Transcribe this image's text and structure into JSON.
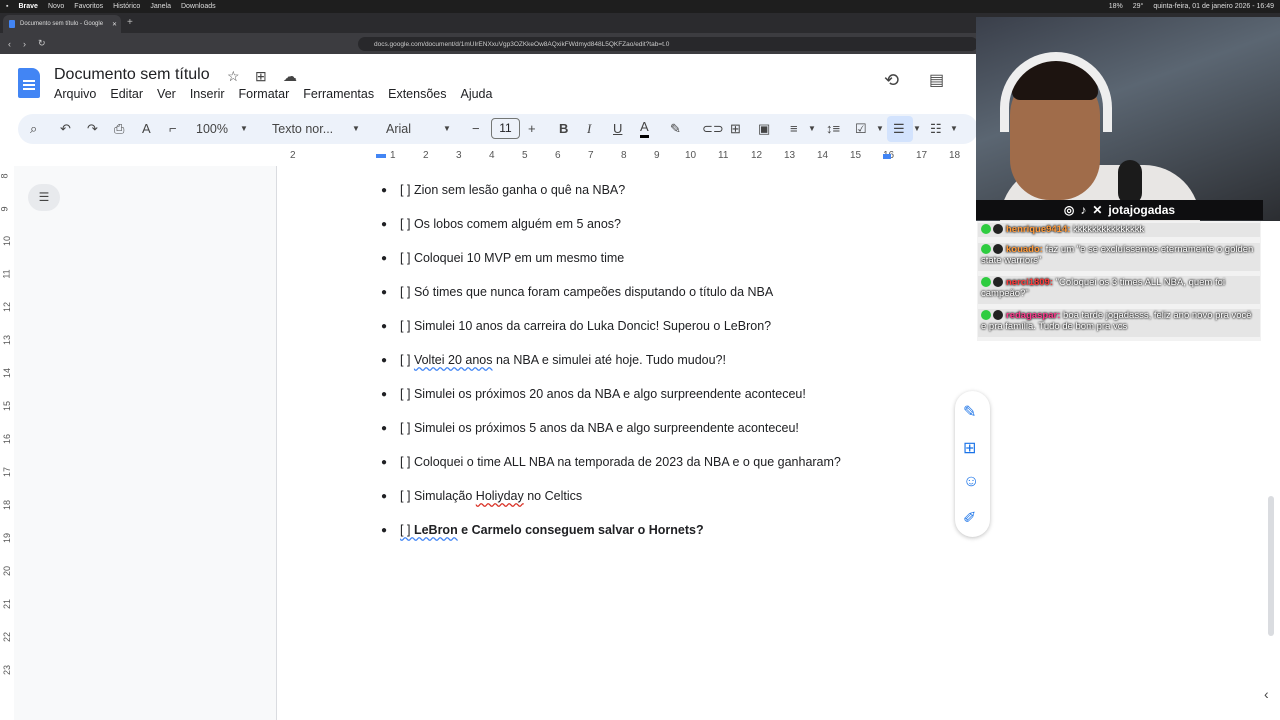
{
  "system_menubar": {
    "app": "Brave",
    "items": [
      "Novo",
      "Favoritos",
      "Histórico",
      "Janela",
      "Downloads"
    ],
    "status": [
      "18%",
      "29°",
      "quinta-feira, 01 de janeiro 2026 - 16:49"
    ]
  },
  "browser": {
    "tab_title": "Documento sem título - Google",
    "url": "docs.google.com/document/d/1mUIrENXxuVgp3OZKkeOw8AQxikFWdmyd848L5QKFZao/edit?tab=t.0"
  },
  "doc": {
    "title": "Documento sem título",
    "menus": [
      "Arquivo",
      "Editar",
      "Ver",
      "Inserir",
      "Formatar",
      "Ferramentas",
      "Extensões",
      "Ajuda"
    ],
    "zoom": "100%",
    "style": "Texto nor...",
    "font": "Arial",
    "font_size": "11",
    "ruler": [
      "2",
      "1",
      "1",
      "2",
      "3",
      "4",
      "5",
      "6",
      "7",
      "8",
      "9",
      "10",
      "11",
      "12",
      "13",
      "14",
      "15",
      "16",
      "17",
      "18"
    ],
    "vruler": [
      "8",
      "9",
      "10",
      "11",
      "12",
      "13",
      "14",
      "15",
      "16",
      "17",
      "18",
      "19",
      "20",
      "21",
      "22",
      "23"
    ],
    "items": [
      {
        "prefix": "[ ] ",
        "text": "Zion sem lesão ganha o quê na NBA?"
      },
      {
        "prefix": "[ ] ",
        "text": "Os lobos comem alguém em 5 anos?"
      },
      {
        "prefix": "[ ] ",
        "text": "Coloquei 10 MVP em um mesmo time"
      },
      {
        "prefix": "[ ] ",
        "text": "Só times que nunca foram campeões disputando o título da NBA"
      },
      {
        "prefix": "[ ] ",
        "text": "Simulei 10 anos da carreira do Luka Doncic! Superou o LeBron?"
      },
      {
        "prefix": "[ ] ",
        "squig": "Voltei 20 anos",
        "text": " na NBA e simulei até hoje. Tudo mudou?!"
      },
      {
        "prefix": "[ ] ",
        "text": "Simulei os próximos 20 anos da NBA e algo surpreendente aconteceu!"
      },
      {
        "prefix": "[ ] ",
        "text": "Simulei os próximos 5 anos da NBA e algo surpreendente aconteceu!"
      },
      {
        "prefix": "[ ] ",
        "text": "Coloquei o time ALL NBA na temporada de 2023 da NBA e o que ganharam?"
      },
      {
        "prefix": "[ ] ",
        "pre": "Simulação ",
        "squig": "Holiyday",
        "text": " no Celtics"
      },
      {
        "prefix": "[ ] ",
        "squig": "LeBron",
        "text": " e Carmelo conseguem salvar o Hornets?",
        "bold": true
      }
    ]
  },
  "stream": {
    "channel": "jotajogadas",
    "chat": [
      {
        "user": "henrique9414:",
        "text": " kkkkkkkkkkkkkkk"
      },
      {
        "user": "kouado:",
        "text": " faz um \"e se excluíssemos eternamente o golden state warriors\""
      },
      {
        "user": "nerci1809:",
        "text": " \"Coloquei os 3 times ALL NBA, quem foi campeão?\""
      },
      {
        "user": "redagaspar:",
        "text": " boa tarde jogadasss, feliz ano novo pra você e pra família. Tudo de bom pra vcs"
      }
    ]
  }
}
